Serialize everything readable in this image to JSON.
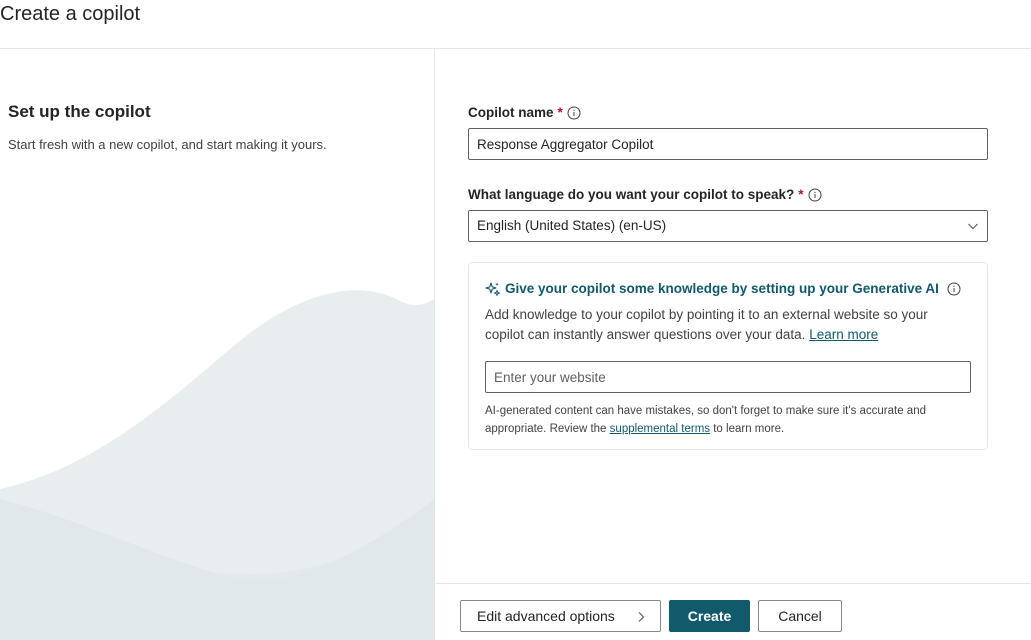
{
  "header": {
    "title": "Create a copilot"
  },
  "left": {
    "title": "Set up the copilot",
    "description": "Start fresh with a new copilot, and start making it yours."
  },
  "form": {
    "name_label": "Copilot name",
    "name_required": "*",
    "name_value": "Response Aggregator Copilot",
    "language_label": "What language do you want your copilot to speak?",
    "language_required": "*",
    "language_value": "English (United States) (en-US)"
  },
  "knowledge": {
    "title": "Give your copilot some knowledge by setting up your Generative AI",
    "description": "Add knowledge to your copilot by pointing it to an external website so your copilot can instantly answer questions over your data.",
    "learn_more": "Learn more",
    "website_placeholder": "Enter your website",
    "disclaimer_before": "AI-generated content can have mistakes, so don't forget to make sure it's accurate and appropriate. Review the",
    "disclaimer_link": "supplemental terms",
    "disclaimer_after": "to learn more."
  },
  "footer": {
    "advanced_label": "Edit advanced options",
    "create_label": "Create",
    "cancel_label": "Cancel"
  },
  "icons": {
    "info": "info-icon",
    "sparkle": "sparkle-icon",
    "chevron_down": "chevron-down-icon",
    "chevron_right": "chevron-right-icon"
  },
  "colors": {
    "brand": "#115a6b",
    "required": "#c50f1f",
    "link": "#0f6cbd",
    "wave_light": "#e8eeef",
    "wave_dark": "#dde6e8"
  }
}
